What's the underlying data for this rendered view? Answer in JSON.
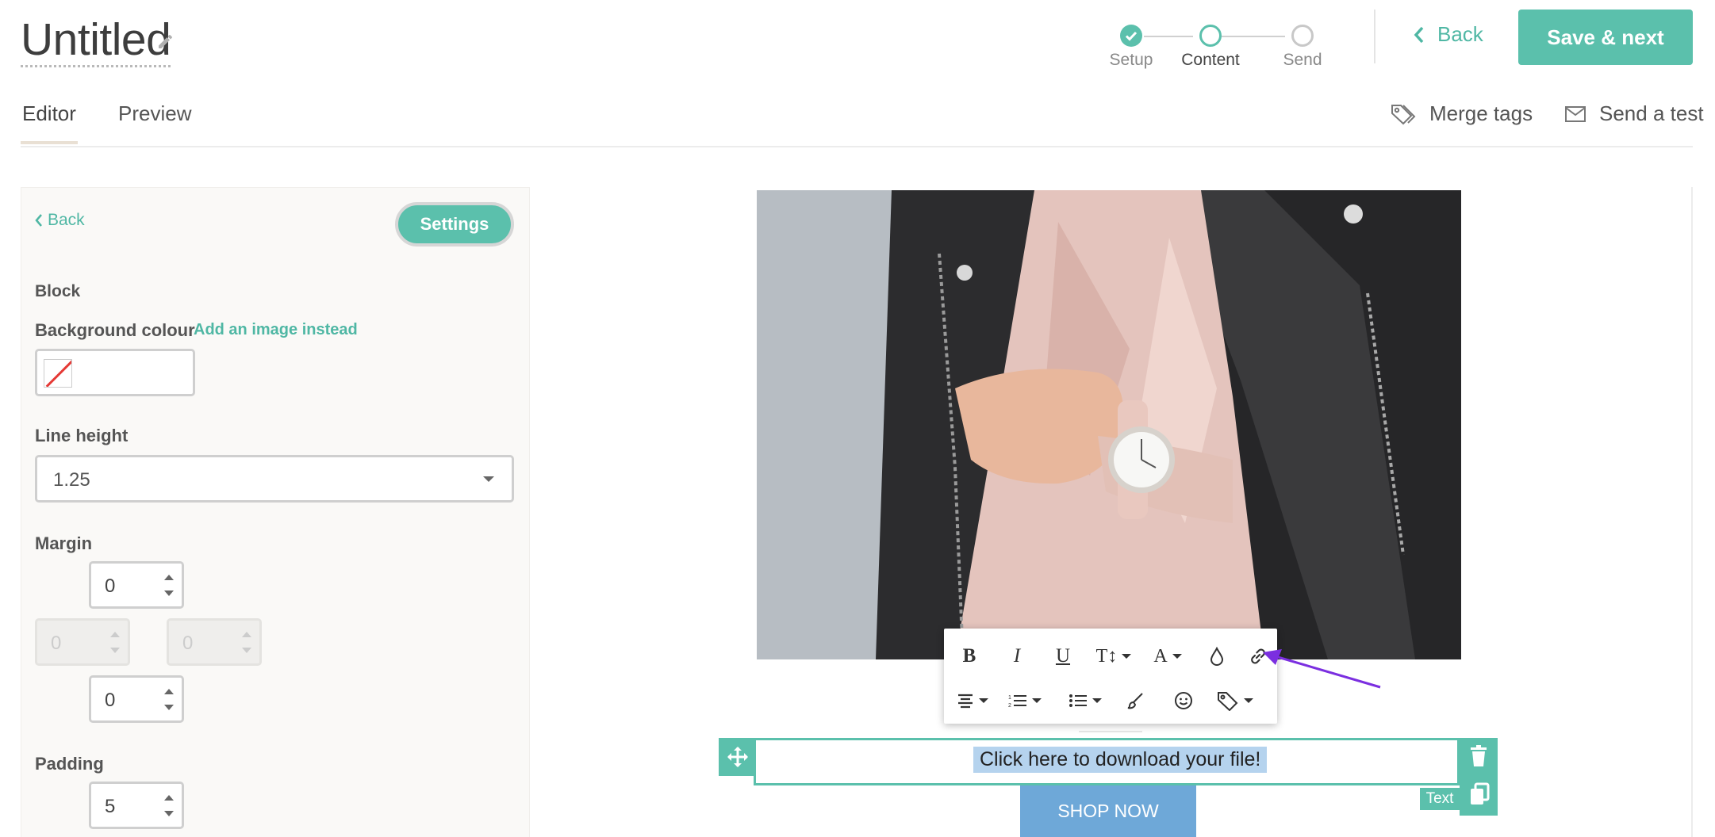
{
  "header": {
    "title": "Untitled",
    "steps": [
      {
        "label": "Setup",
        "state": "done"
      },
      {
        "label": "Content",
        "state": "current"
      },
      {
        "label": "Send",
        "state": "todo"
      }
    ],
    "back_label": "Back",
    "save_label": "Save & next"
  },
  "tabs": [
    {
      "label": "Editor",
      "active": true
    },
    {
      "label": "Preview",
      "active": false
    }
  ],
  "tools": {
    "merge_tags": "Merge tags",
    "send_test": "Send a test"
  },
  "panel": {
    "back_label": "Back",
    "settings_label": "Settings",
    "block_label": "Block",
    "background_colour_label": "Background colour",
    "add_image_label": "Add an image instead",
    "line_height_label": "Line height",
    "line_height_value": "1.25",
    "margin_label": "Margin",
    "margin": {
      "top": "0",
      "left": "0",
      "right": "0",
      "bottom": "0"
    },
    "padding_label": "Padding",
    "padding": {
      "top": "5"
    }
  },
  "canvas": {
    "text_content": "Click here to download your file!",
    "text_tag": "Text",
    "shop_button": "SHOP NOW",
    "toolbar": {
      "row1": [
        "bold-icon",
        "italic-icon",
        "underline-icon",
        "font-size-icon",
        "font-color-icon",
        "highlight-icon",
        "link-icon"
      ],
      "row2": [
        "align-icon",
        "ordered-list-icon",
        "unordered-list-icon",
        "brush-icon",
        "emoji-icon",
        "tag-icon"
      ]
    }
  },
  "colors": {
    "accent": "#5bc0ac",
    "accent_text": "#4fb7a4",
    "shop_button": "#6ea8d8",
    "selection": "#b5d3ee",
    "annotation_arrow": "#7b2fe0"
  }
}
